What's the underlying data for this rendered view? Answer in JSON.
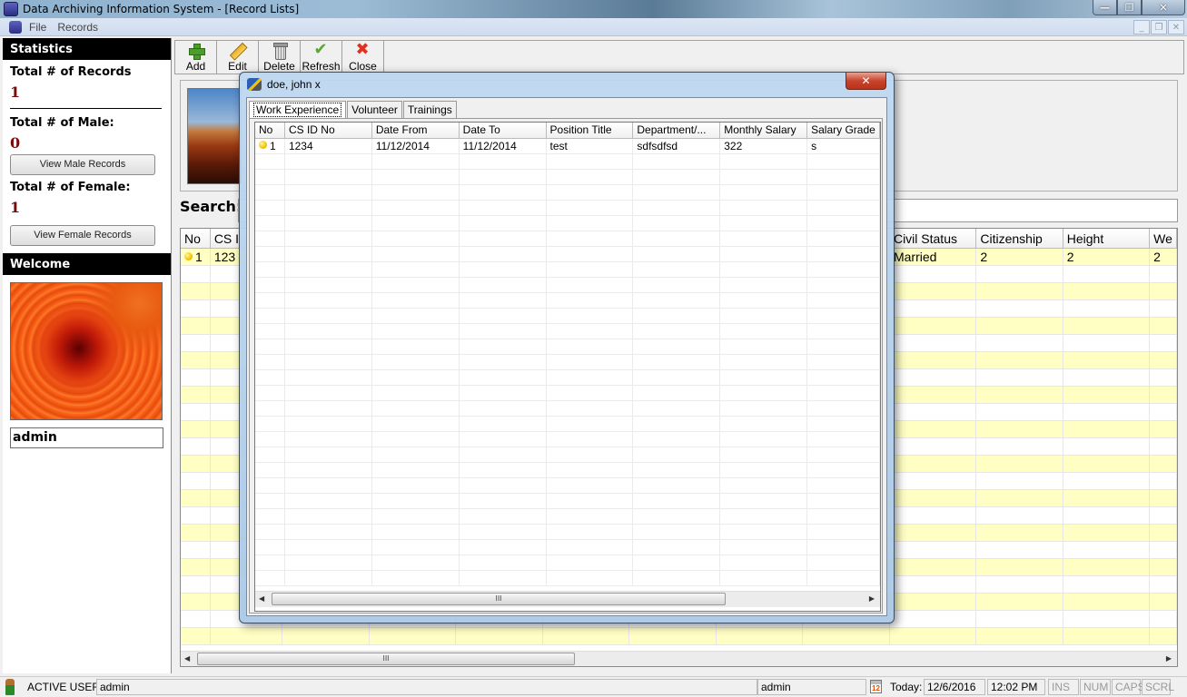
{
  "window": {
    "title": "Data Archiving Information System - [Record Lists]",
    "controls": {
      "minimize": "—",
      "maximize": "❐",
      "close": "✕"
    }
  },
  "menu": {
    "items": [
      "File",
      "Records"
    ],
    "mdi_controls": {
      "minimize": "_",
      "restore": "❐",
      "close": "✕"
    }
  },
  "sidebar": {
    "statistics_header": "Statistics",
    "total_records_label": "Total # of Records",
    "total_records_value": "1",
    "total_male_label": "Total # of Male:",
    "total_male_value": "0",
    "view_male_button": "View Male Records",
    "total_female_label": "Total # of Female:",
    "total_female_value": "1",
    "view_female_button": "View Female Records",
    "welcome_header": "Welcome",
    "username": "admin"
  },
  "toolbar": {
    "buttons": [
      {
        "label": "Add",
        "icon": "add-icon"
      },
      {
        "label": "Edit",
        "icon": "edit-icon"
      },
      {
        "label": "Delete",
        "icon": "delete-icon"
      },
      {
        "label": "Refresh",
        "icon": "refresh-icon"
      },
      {
        "label": "Close",
        "icon": "close-icon"
      }
    ]
  },
  "search": {
    "label": "Search:",
    "value": ""
  },
  "main_grid": {
    "left_columns": [
      "No",
      "CS I"
    ],
    "right_columns": [
      "Civil Status",
      "Citizenship",
      "Height",
      "We"
    ],
    "rows": [
      {
        "no": "1",
        "cs_id": "123",
        "civil_status": "Married",
        "citizenship": "2",
        "height": "2",
        "weight": "2"
      }
    ]
  },
  "dialog": {
    "title": "doe, john x",
    "close": "✕",
    "tabs": [
      "Work Experience",
      "Volunteer",
      "Trainings"
    ],
    "active_tab": "Work Experience",
    "columns": [
      "No",
      "CS ID No",
      "Date From",
      "Date To",
      "Position Title",
      "Department/...",
      "Monthly Salary",
      "Salary Grade"
    ],
    "rows": [
      {
        "no": "1",
        "cs_id": "1234",
        "date_from": "11/12/2014",
        "date_to": "11/12/2014",
        "position": "test",
        "department": "sdfsdfsd",
        "salary": "322",
        "grade": "s"
      }
    ]
  },
  "statusbar": {
    "active_user_label": "ACTIVE USER:",
    "active_user_value": "admin",
    "user_field": "admin",
    "calendar_icon_text": "12",
    "today_label": "Today:",
    "date": "12/6/2016",
    "time": "12:02 PM",
    "keys": [
      "INS",
      "NUM",
      "CAPS",
      "SCRL"
    ]
  },
  "scroll_marker": "III"
}
